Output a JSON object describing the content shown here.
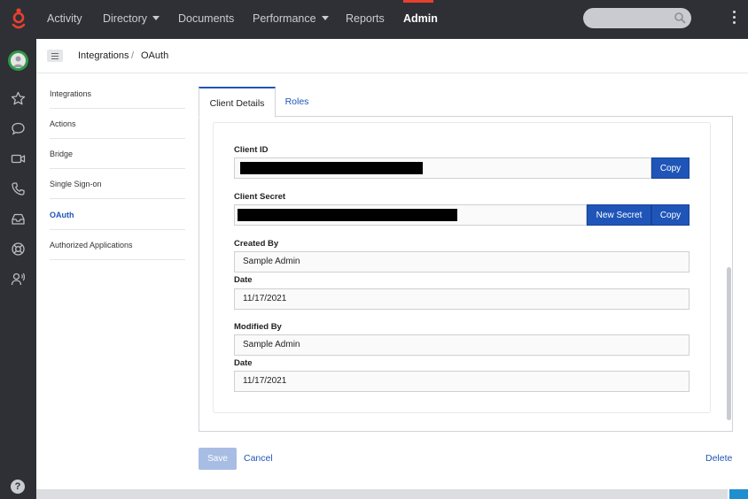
{
  "topbar": {
    "nav": [
      {
        "label": "Activity",
        "has_caret": false
      },
      {
        "label": "Directory",
        "has_caret": true
      },
      {
        "label": "Documents",
        "has_caret": false
      },
      {
        "label": "Performance",
        "has_caret": true
      },
      {
        "label": "Reports",
        "has_caret": false
      },
      {
        "label": "Admin",
        "has_caret": false,
        "active": true
      }
    ],
    "search_placeholder": "",
    "accent_color": "#e8402f"
  },
  "rail": {
    "icons": [
      "star-icon",
      "chat-icon",
      "video-icon",
      "phone-icon",
      "inbox-icon",
      "lifebuoy-icon",
      "user-voice-icon"
    ],
    "help_label": "?"
  },
  "breadcrumb": {
    "items": [
      "Integrations",
      "OAuth"
    ],
    "separator": "/"
  },
  "sidenav": {
    "items": [
      {
        "label": "Integrations",
        "active": false
      },
      {
        "label": "Actions",
        "active": false
      },
      {
        "label": "Bridge",
        "active": false
      },
      {
        "label": "Single Sign-on",
        "active": false
      },
      {
        "label": "OAuth",
        "active": true
      },
      {
        "label": "Authorized Applications",
        "active": false
      }
    ]
  },
  "tabs": [
    {
      "label": "Client Details",
      "active": true
    },
    {
      "label": "Roles",
      "active": false
    }
  ],
  "form": {
    "client_id_label": "Client ID",
    "client_id_copy": "Copy",
    "client_secret_label": "Client Secret",
    "new_secret_button": "New Secret",
    "client_secret_copy": "Copy",
    "created_by_label": "Created By",
    "created_by_value": "Sample Admin",
    "created_date_label": "Date",
    "created_date_value": "11/17/2021",
    "modified_by_label": "Modified By",
    "modified_by_value": "Sample Admin",
    "modified_date_label": "Date",
    "modified_date_value": "11/17/2021"
  },
  "footer": {
    "save": "Save",
    "cancel": "Cancel",
    "delete": "Delete"
  },
  "colors": {
    "primary": "#1f55b8",
    "topbar_bg": "#2e3036",
    "avatar_ring": "#2e9a47"
  }
}
